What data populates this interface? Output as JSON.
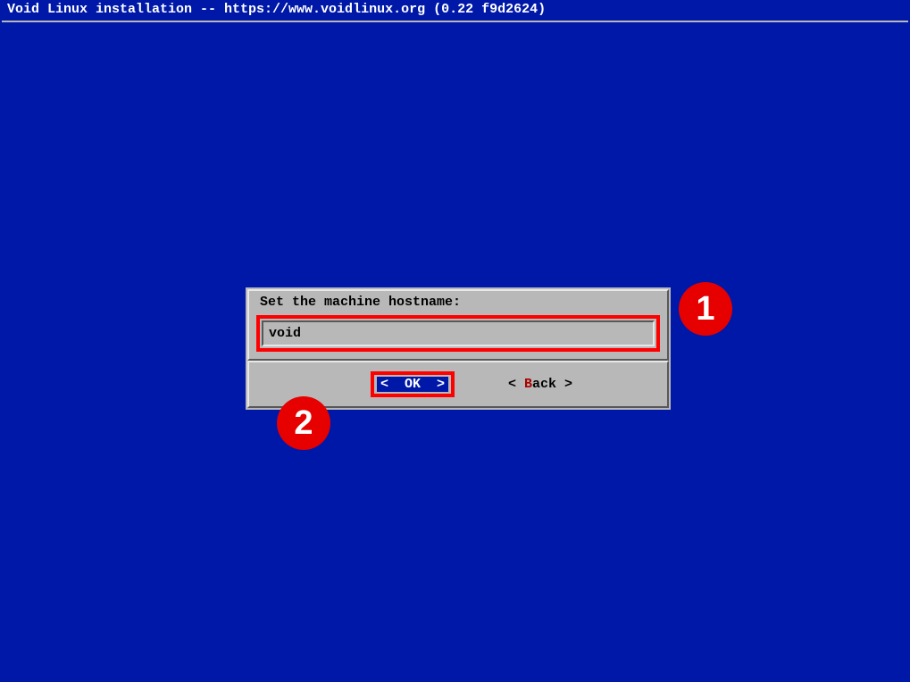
{
  "header": {
    "title": "Void Linux installation -- https://www.voidlinux.org (0.22 f9d2624)"
  },
  "dialog": {
    "prompt": "Set the machine hostname:",
    "input_value": "void",
    "ok_label": "<  OK  >",
    "back_prefix": "< ",
    "back_highlight": "B",
    "back_rest": "ack >"
  },
  "annotations": {
    "badge1": "1",
    "badge2": "2"
  }
}
